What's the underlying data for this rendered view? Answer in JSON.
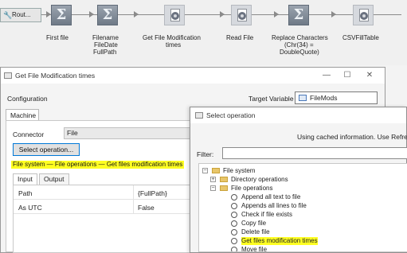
{
  "workflow": {
    "nodes": [
      {
        "label": "Rout..."
      },
      {
        "label": "First file"
      },
      {
        "label1": "Filename",
        "label2": "FileDate",
        "label3": "FullPath"
      },
      {
        "label1": "Get File Modification",
        "label2": "times"
      },
      {
        "label": "Read File"
      },
      {
        "label1": "Replace Characters",
        "label2": "(Chr(34) =",
        "label3": "DoubleQuote)"
      },
      {
        "label": "CSVFillTable"
      }
    ]
  },
  "dialog1": {
    "title": "Get File Modification times",
    "buttons": {
      "minimize": "—",
      "maximize": "☐",
      "close": "✕"
    },
    "configuration_label": "Configuration",
    "target_variable_label": "Target Variable",
    "target_variable_value": "FileMods",
    "tab_machine": "Machine",
    "connector_label": "Connector",
    "connector_value": "File",
    "select_operation_button": "Select operation...",
    "operation_path": "File system — File operations — Get files modification times",
    "tabs": {
      "input": "Input",
      "output": "Output"
    },
    "params": [
      {
        "name": "Path",
        "value": "{FullPath}"
      },
      {
        "name": "As UTC",
        "value": "False"
      }
    ]
  },
  "dialog2": {
    "title": "Select operation",
    "cached_info": "Using cached information. Use Refresh",
    "filter_label": "Filter:",
    "filter_value": "",
    "tree": {
      "root": "File system",
      "directory_ops": "Directory operations",
      "file_ops": "File operations",
      "items": [
        "Append all text to file",
        "Appends all lines to file",
        "Check if file exists",
        "Copy file",
        "Delete file",
        "Get files modification times",
        "Move file"
      ]
    }
  },
  "colors": {
    "highlight": "#ffff22",
    "accent_border": "#0078d7"
  }
}
